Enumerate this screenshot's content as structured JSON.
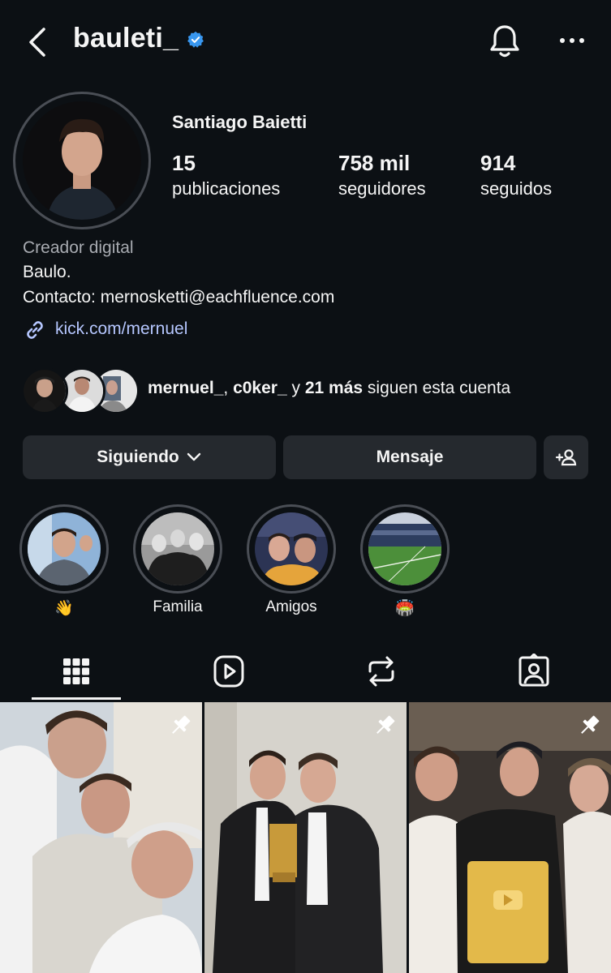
{
  "header": {
    "username": "bauleti_",
    "verified": true,
    "icons": [
      "back-icon",
      "verified-badge-icon",
      "bell-icon",
      "more-icon"
    ]
  },
  "profile": {
    "full_name": "Santiago Baietti",
    "stats": [
      {
        "value": "15",
        "label": "publicaciones"
      },
      {
        "value": "758 mil",
        "label": "seguidores"
      },
      {
        "value": "914",
        "label": "seguidos"
      }
    ],
    "category": "Creador digital",
    "bio_line1": "Baulo.",
    "bio_line2": "Contacto: mernosketti@eachfluence.com",
    "link": "kick.com/mernuel"
  },
  "mutual": {
    "user1": "mernuel_",
    "separator": ",",
    "user2": "c0ker_",
    "conj": "y",
    "more": "21 más",
    "suffix": "siguen esta cuenta"
  },
  "actions": {
    "following": "Siguiendo",
    "message": "Mensaje"
  },
  "highlights": [
    {
      "label": "👋"
    },
    {
      "label": "Familia"
    },
    {
      "label": "Amigos"
    },
    {
      "label": "🏟️"
    }
  ],
  "tabs": [
    "grid-icon",
    "reels-icon",
    "reposts-icon",
    "tagged-icon"
  ],
  "colors": {
    "background": "#0c1014",
    "button": "#25292e",
    "link": "#b6c7ff",
    "verified": "#3897f0",
    "secondary_text": "#a8abb1"
  }
}
